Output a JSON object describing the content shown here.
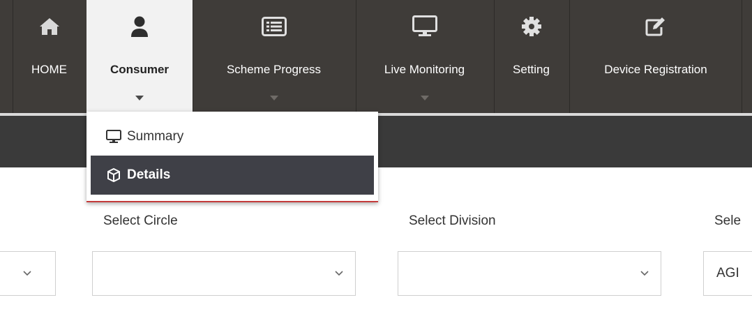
{
  "nav": {
    "items": [
      {
        "label": "HOME",
        "icon": "home-icon"
      },
      {
        "label": "Consumer",
        "icon": "user-icon"
      },
      {
        "label": "Scheme Progress",
        "icon": "list-icon"
      },
      {
        "label": "Live Monitoring",
        "icon": "monitor-icon"
      },
      {
        "label": "Setting",
        "icon": "gear-icon"
      },
      {
        "label": "Device Registration",
        "icon": "edit-icon"
      }
    ]
  },
  "dropdown": {
    "items": [
      {
        "label": "Summary",
        "icon": "monitor-icon"
      },
      {
        "label": "Details",
        "icon": "cube-icon"
      }
    ]
  },
  "form": {
    "circle_label": "Select Circle",
    "division_label": "Select Division",
    "next_label": "Sele",
    "next_value": "AGI"
  },
  "colors": {
    "navbar": "#3f3c39",
    "active_tab": "#f2f2f2",
    "dropdown_selected": "#3f4047",
    "accent_underline": "#c43b3b"
  }
}
